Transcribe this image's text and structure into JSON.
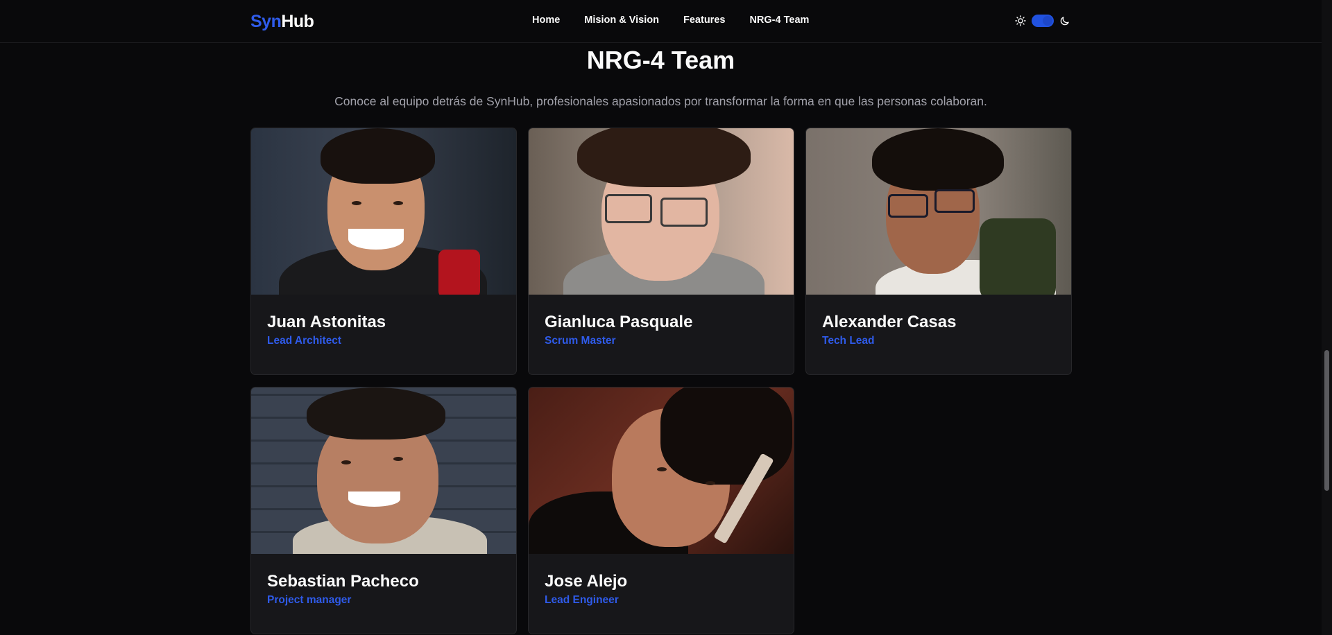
{
  "brand": {
    "part1": "Syn",
    "part2": "Hub",
    "accent_color": "#2f5bea"
  },
  "nav": {
    "links": [
      "Home",
      "Mision & Vision",
      "Features",
      "NRG-4 Team"
    ]
  },
  "theme_toggle": {
    "light_icon": "sun-icon",
    "dark_icon": "moon-icon",
    "state": "dark"
  },
  "team_section": {
    "title": "NRG-4 Team",
    "subtitle": "Conoce al equipo detrás de SynHub, profesionales apasionados por transformar la forma en que las personas colaboran.",
    "members": [
      {
        "name": "Juan Astonitas",
        "role": "Lead Architect"
      },
      {
        "name": "Gianluca Pasquale",
        "role": "Scrum Master"
      },
      {
        "name": "Alexander Casas",
        "role": "Tech Lead"
      },
      {
        "name": "Sebastian Pacheco",
        "role": "Project manager"
      },
      {
        "name": "Jose Alejo",
        "role": "Lead Engineer"
      }
    ]
  }
}
